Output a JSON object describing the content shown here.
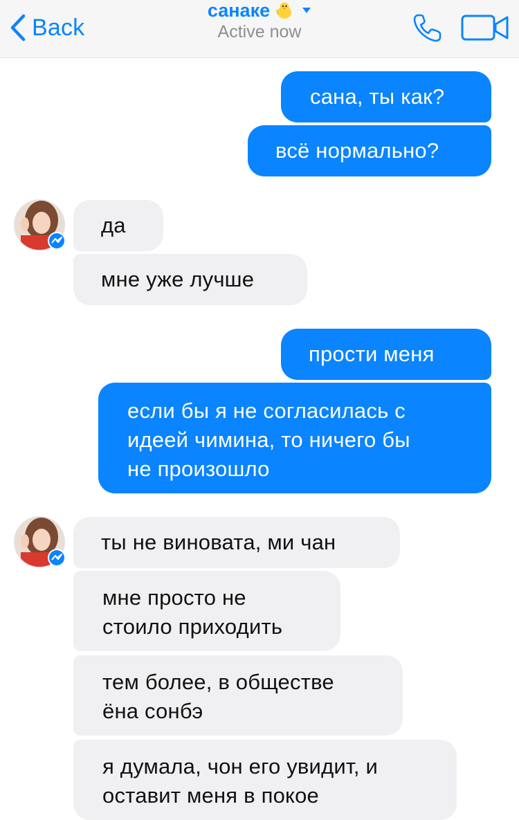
{
  "header": {
    "back_label": "Back",
    "contact_name": "санаке",
    "contact_emoji": "chick-icon",
    "status": "Active now",
    "accent_color": "#0a84ff"
  },
  "messages": [
    {
      "direction": "out",
      "text": "сана, ты как?"
    },
    {
      "direction": "out",
      "text": "всё нормально?"
    },
    {
      "direction": "in",
      "text": "да"
    },
    {
      "direction": "in",
      "text": "мне уже лучше"
    },
    {
      "direction": "out",
      "text": "прости меня"
    },
    {
      "direction": "out",
      "lines": [
        "если бы я не согласилась с",
        "идеей чимина, то ничего бы",
        "не произошло"
      ]
    },
    {
      "direction": "in",
      "text": "ты не виновата, ми чан"
    },
    {
      "direction": "in",
      "lines": [
        "мне просто не",
        "стоило приходить"
      ]
    },
    {
      "direction": "in",
      "lines": [
        "тем более, в обществе",
        "ёна сонбэ"
      ]
    },
    {
      "direction": "in",
      "lines": [
        "я думала, чон его увидит, и",
        "оставит меня в покое"
      ]
    }
  ]
}
